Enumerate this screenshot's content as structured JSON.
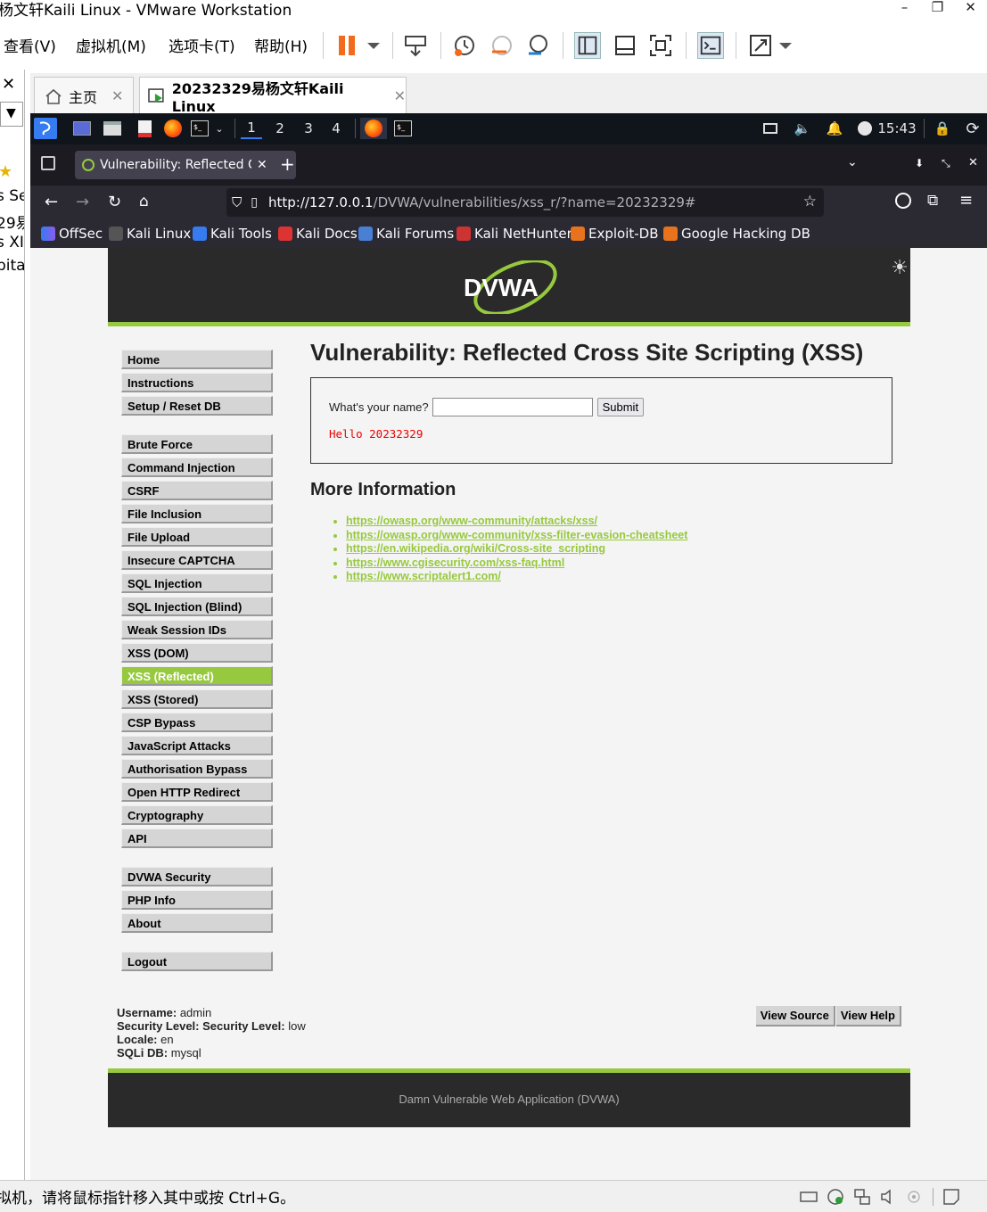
{
  "vmware": {
    "title": "杨文轩Kaili Linux - VMware Workstation",
    "menu": [
      "查看(V)",
      "虚拟机(M)",
      "选项卡(T)",
      "帮助(H)"
    ],
    "tabs": [
      {
        "label": "主页"
      },
      {
        "label": "20232329易杨文轩Kaili Linux"
      }
    ],
    "left_fragments": [
      "s Se",
      "29易",
      "s XI",
      "pita"
    ],
    "status_message": "拟机，请将鼠标指针移入其中或按 Ctrl+G。"
  },
  "kali_panel": {
    "workspaces": [
      "1",
      "2",
      "3",
      "4"
    ],
    "clock": "15:43"
  },
  "firefox": {
    "tab_title": "Vulnerability: Reflected Cr",
    "url_host": "http://127.0.0.1",
    "url_path": "/DVWA/vulnerabilities/xss_r/?name=20232329#",
    "bookmarks": [
      "OffSec",
      "Kali Linux",
      "Kali Tools",
      "Kali Docs",
      "Kali Forums",
      "Kali NetHunter",
      "Exploit-DB",
      "Google Hacking DB"
    ]
  },
  "dvwa": {
    "logo_text": "DVWA",
    "menu_group1": [
      "Home",
      "Instructions",
      "Setup / Reset DB"
    ],
    "menu_group2": [
      "Brute Force",
      "Command Injection",
      "CSRF",
      "File Inclusion",
      "File Upload",
      "Insecure CAPTCHA",
      "SQL Injection",
      "SQL Injection (Blind)",
      "Weak Session IDs",
      "XSS (DOM)",
      "XSS (Reflected)",
      "XSS (Stored)",
      "CSP Bypass",
      "JavaScript Attacks",
      "Authorisation Bypass",
      "Open HTTP Redirect",
      "Cryptography",
      "API"
    ],
    "menu_group3": [
      "DVWA Security",
      "PHP Info",
      "About"
    ],
    "menu_group4": [
      "Logout"
    ],
    "active_item": "XSS (Reflected)",
    "page_title": "Vulnerability: Reflected Cross Site Scripting (XSS)",
    "form": {
      "question": "What's your name?",
      "input_value": "",
      "submit_label": "Submit",
      "result": "Hello 20232329"
    },
    "more_info_heading": "More Information",
    "links": [
      "https://owasp.org/www-community/attacks/xss/",
      "https://owasp.org/www-community/xss-filter-evasion-cheatsheet",
      "https://en.wikipedia.org/wiki/Cross-site_scripting",
      "https://www.cgisecurity.com/xss-faq.html",
      "https://www.scriptalert1.com/"
    ],
    "info": {
      "username_label": "Username:",
      "username": "admin",
      "security_label": "Security Level:",
      "security_prefix_label": "Security Level:",
      "security": "low",
      "locale_label": "Locale:",
      "locale": "en",
      "sqli_label": "SQLi DB:",
      "sqli": "mysql"
    },
    "view_source": "View Source",
    "view_help": "View Help",
    "footer": "Damn Vulnerable Web Application (DVWA)"
  },
  "colors": {
    "dvwa_green": "#97c93e",
    "dvwa_dark": "#2a2a2a",
    "firefox_dark": "#2b2a33",
    "kali_panel": "#10151c"
  }
}
